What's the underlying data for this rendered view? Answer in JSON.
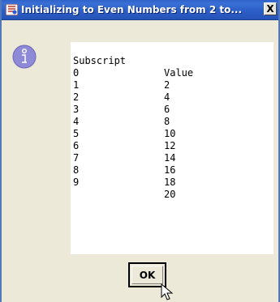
{
  "window": {
    "title": "Initializing to Even Numbers from 2 to...",
    "close_glyph": "X"
  },
  "icons": {
    "app": "java-app-icon",
    "message": "information-icon",
    "cursor": "mouse-pointer"
  },
  "table": {
    "headers": [
      "Subscript",
      "Value"
    ],
    "rows": [
      [
        "0",
        "2"
      ],
      [
        "1",
        "4"
      ],
      [
        "2",
        "6"
      ],
      [
        "3",
        "8"
      ],
      [
        "4",
        "10"
      ],
      [
        "5",
        "12"
      ],
      [
        "6",
        "14"
      ],
      [
        "7",
        "16"
      ],
      [
        "8",
        "18"
      ],
      [
        "9",
        "20"
      ]
    ]
  },
  "buttons": {
    "ok": "OK"
  },
  "colors": {
    "titlebar": "#2c5fc7",
    "dialog_bg": "#ece9d8",
    "text_area_bg": "#ffffff",
    "info_icon": "#8f8ad6"
  }
}
